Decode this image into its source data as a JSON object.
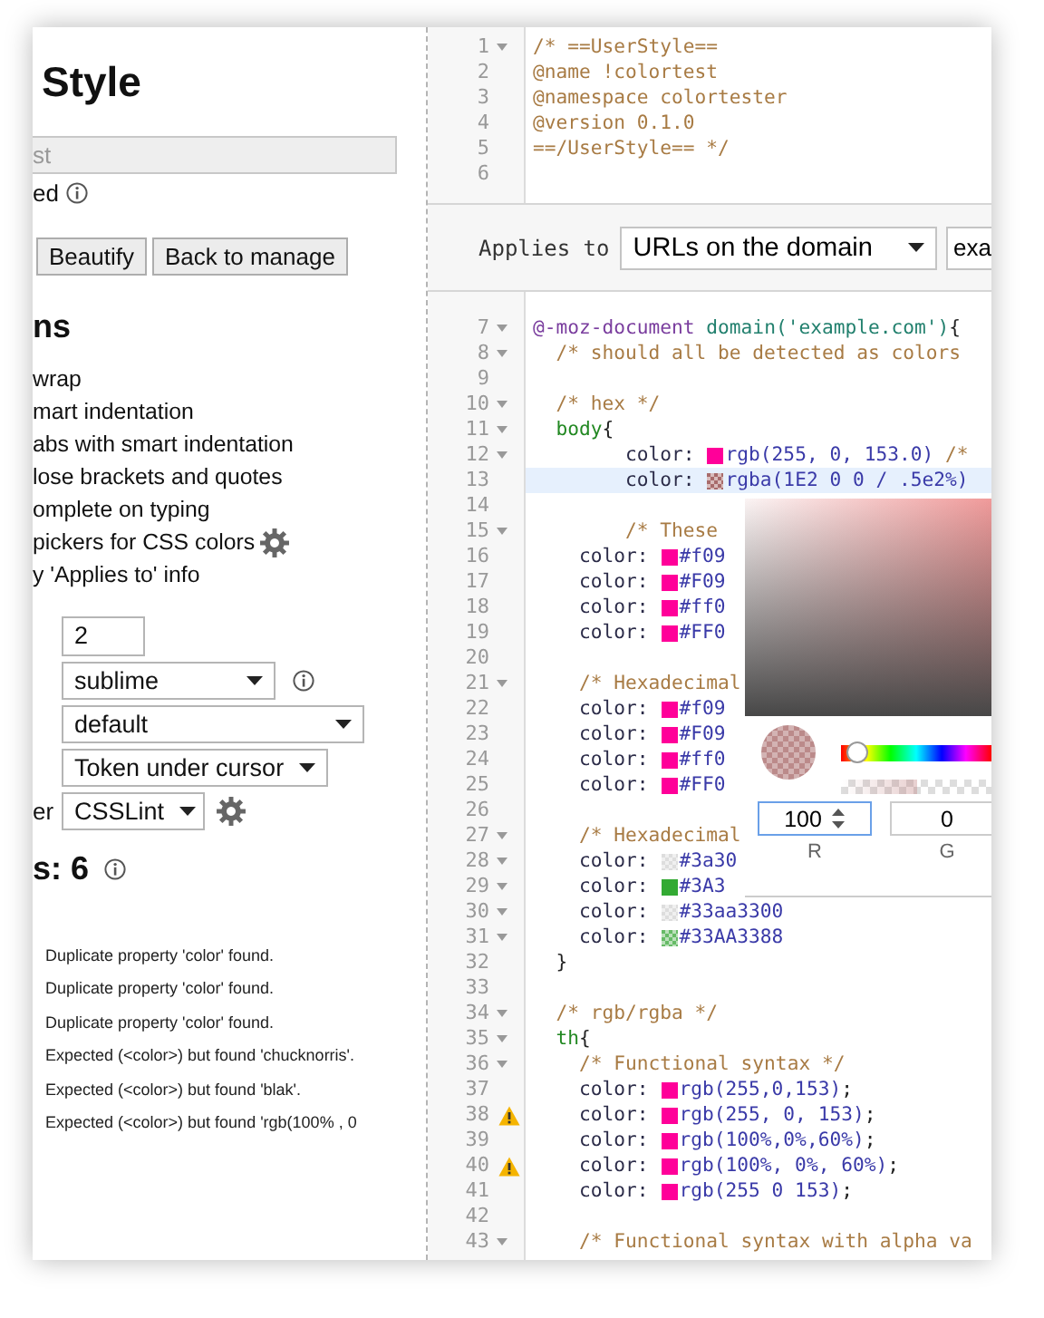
{
  "left_panel": {
    "title": "Style",
    "name_field": {
      "placeholder": "st"
    },
    "enabled": {
      "label": "ed",
      "info": true
    },
    "buttons": [
      {
        "label": "Beautify"
      },
      {
        "label": "Back to manage"
      }
    ],
    "options_heading": "ns",
    "options": [
      {
        "label": "wrap",
        "settings": false
      },
      {
        "label": "mart indentation",
        "settings": false
      },
      {
        "label": "abs with smart indentation",
        "settings": false
      },
      {
        "label": "lose brackets and quotes",
        "settings": false
      },
      {
        "label": "omplete on typing",
        "settings": false
      },
      {
        "label": "pickers for CSS colors",
        "settings": true
      },
      {
        "label": "y 'Applies to' info",
        "settings": false
      }
    ],
    "editor_settings": [
      {
        "kind": "input",
        "value": "2"
      },
      {
        "kind": "select",
        "value": "sublime",
        "info": true,
        "settings": false
      },
      {
        "kind": "select",
        "value": "default",
        "info": false,
        "settings": false
      },
      {
        "kind": "select",
        "value": "Token under cursor",
        "info": false,
        "settings": false
      },
      {
        "kind": "select",
        "label": "er",
        "value": "CSSLint",
        "info": false,
        "settings": true
      }
    ],
    "issues": {
      "heading": "s: 6",
      "info": true,
      "items": [
        "Duplicate property 'color' found.",
        "Duplicate property 'color' found.",
        "Duplicate property 'color' found.",
        "Expected (<color>) but found 'chucknorris'.",
        "Expected (<color>) but found 'blak'.",
        "Expected (<color>) but found 'rgb(100% , 0"
      ]
    }
  },
  "editor": {
    "header_lines": [
      {
        "number": "1",
        "fold": true,
        "warning": false,
        "active": false,
        "tokens": [
          {
            "kind": "comment",
            "text": "/* ==UserStyle=="
          }
        ]
      },
      {
        "number": "2",
        "fold": false,
        "warning": false,
        "active": false,
        "tokens": [
          {
            "kind": "comment",
            "text": "@name !colortest"
          }
        ]
      },
      {
        "number": "3",
        "fold": false,
        "warning": false,
        "active": false,
        "tokens": [
          {
            "kind": "comment",
            "text": "@namespace colortester"
          }
        ]
      },
      {
        "number": "4",
        "fold": false,
        "warning": false,
        "active": false,
        "tokens": [
          {
            "kind": "comment",
            "text": "@version 0.1.0"
          }
        ]
      },
      {
        "number": "5",
        "fold": false,
        "warning": false,
        "active": false,
        "tokens": [
          {
            "kind": "comment",
            "text": "==/UserStyle== */"
          }
        ]
      },
      {
        "number": "6",
        "fold": false,
        "warning": false,
        "active": false
      }
    ],
    "applies_to": {
      "label": "Applies to",
      "type": "URLs on the domain",
      "value": "exa"
    },
    "lines": [
      {
        "number": "7",
        "fold": true,
        "warning": false,
        "active": false,
        "tokens": [
          {
            "kind": "keyword",
            "text": "@-moz-document"
          },
          {
            "kind": "function",
            "text": " domain('example.com')"
          },
          {
            "kind": "plain",
            "text": "{"
          }
        ]
      },
      {
        "number": "8",
        "fold": true,
        "warning": false,
        "active": false,
        "tokens": [
          {
            "kind": "comment",
            "text": "  /* should all be detected as colors"
          }
        ]
      },
      {
        "number": "9",
        "fold": false,
        "warning": false,
        "active": false
      },
      {
        "number": "10",
        "fold": true,
        "warning": false,
        "active": false,
        "tokens": [
          {
            "kind": "comment",
            "text": "  /* hex */"
          }
        ]
      },
      {
        "number": "11",
        "fold": true,
        "warning": false,
        "active": false,
        "tokens": [
          {
            "kind": "tag",
            "text": "  body"
          },
          {
            "kind": "plain",
            "text": "{"
          }
        ]
      },
      {
        "number": "12",
        "fold": true,
        "warning": false,
        "active": false,
        "tokens": [
          {
            "kind": "property",
            "text": "        color:"
          },
          {
            "kind": "swatch",
            "color": "#ff0099",
            "checkered": false
          },
          {
            "kind": "atom",
            "text": "rgb(255, 0, 153.0)"
          },
          {
            "kind": "comment",
            "text": " /*"
          }
        ]
      },
      {
        "number": "13",
        "fold": false,
        "warning": false,
        "active": true,
        "tokens": [
          {
            "kind": "property",
            "text": "        color:"
          },
          {
            "kind": "swatch",
            "color": "#a86b6b",
            "checkered": true
          },
          {
            "kind": "atom",
            "text": "rgba(1E2 0 0 / .5e2%)"
          }
        ]
      },
      {
        "number": "14",
        "fold": false,
        "warning": false,
        "active": false
      },
      {
        "number": "15",
        "fold": true,
        "warning": false,
        "active": false,
        "tokens": [
          {
            "kind": "comment",
            "text": "        /* These"
          }
        ]
      },
      {
        "number": "16",
        "fold": false,
        "warning": false,
        "active": false,
        "tokens": [
          {
            "kind": "property",
            "text": "    color:"
          },
          {
            "kind": "swatch",
            "color": "#ff0099",
            "checkered": false
          },
          {
            "kind": "atom",
            "text": "#f09"
          }
        ]
      },
      {
        "number": "17",
        "fold": false,
        "warning": false,
        "active": false,
        "tokens": [
          {
            "kind": "property",
            "text": "    color:"
          },
          {
            "kind": "swatch",
            "color": "#ff0099",
            "checkered": false
          },
          {
            "kind": "atom",
            "text": "#F09"
          }
        ]
      },
      {
        "number": "18",
        "fold": false,
        "warning": false,
        "active": false,
        "tokens": [
          {
            "kind": "property",
            "text": "    color:"
          },
          {
            "kind": "swatch",
            "color": "#ff0099",
            "checkered": false
          },
          {
            "kind": "atom",
            "text": "#ff0"
          }
        ]
      },
      {
        "number": "19",
        "fold": false,
        "warning": false,
        "active": false,
        "tokens": [
          {
            "kind": "property",
            "text": "    color:"
          },
          {
            "kind": "swatch",
            "color": "#ff0099",
            "checkered": false
          },
          {
            "kind": "atom",
            "text": "#FF0"
          }
        ]
      },
      {
        "number": "20",
        "fold": false,
        "warning": false,
        "active": false
      },
      {
        "number": "21",
        "fold": true,
        "warning": false,
        "active": false,
        "tokens": [
          {
            "kind": "comment",
            "text": "    /* Hexadecimal"
          }
        ]
      },
      {
        "number": "22",
        "fold": false,
        "warning": false,
        "active": false,
        "tokens": [
          {
            "kind": "property",
            "text": "    color:"
          },
          {
            "kind": "swatch",
            "color": "#ff0099",
            "checkered": false
          },
          {
            "kind": "atom",
            "text": "#f09"
          }
        ]
      },
      {
        "number": "23",
        "fold": false,
        "warning": false,
        "active": false,
        "tokens": [
          {
            "kind": "property",
            "text": "    color:"
          },
          {
            "kind": "swatch",
            "color": "#ff0099",
            "checkered": false
          },
          {
            "kind": "atom",
            "text": "#F09"
          }
        ]
      },
      {
        "number": "24",
        "fold": false,
        "warning": false,
        "active": false,
        "tokens": [
          {
            "kind": "property",
            "text": "    color:"
          },
          {
            "kind": "swatch",
            "color": "#ff0099",
            "checkered": false
          },
          {
            "kind": "atom",
            "text": "#ff0"
          }
        ]
      },
      {
        "number": "25",
        "fold": false,
        "warning": false,
        "active": false,
        "tokens": [
          {
            "kind": "property",
            "text": "    color:"
          },
          {
            "kind": "swatch",
            "color": "#ff0099",
            "checkered": false
          },
          {
            "kind": "atom",
            "text": "#FF0"
          }
        ]
      },
      {
        "number": "26",
        "fold": false,
        "warning": false,
        "active": false
      },
      {
        "number": "27",
        "fold": true,
        "warning": false,
        "active": false,
        "tokens": [
          {
            "kind": "comment",
            "text": "    /* Hexadecimal"
          }
        ]
      },
      {
        "number": "28",
        "fold": true,
        "warning": false,
        "active": false,
        "tokens": [
          {
            "kind": "property",
            "text": "    color:"
          },
          {
            "kind": "swatch",
            "color": "#dddddd",
            "checkered": true
          },
          {
            "kind": "atom",
            "text": "#3a30"
          }
        ]
      },
      {
        "number": "29",
        "fold": true,
        "warning": false,
        "active": false,
        "tokens": [
          {
            "kind": "property",
            "text": "    color:"
          },
          {
            "kind": "swatch",
            "color": "#33aa33",
            "checkered": false
          },
          {
            "kind": "atom",
            "text": "#3A3"
          }
        ]
      },
      {
        "number": "30",
        "fold": true,
        "warning": false,
        "active": false,
        "tokens": [
          {
            "kind": "property",
            "text": "    color:"
          },
          {
            "kind": "swatch",
            "color": "#dddddd",
            "checkered": true
          },
          {
            "kind": "atom",
            "text": "#33aa3300"
          }
        ]
      },
      {
        "number": "31",
        "fold": true,
        "warning": false,
        "active": false,
        "tokens": [
          {
            "kind": "property",
            "text": "    color:"
          },
          {
            "kind": "swatch",
            "color": "#66bb66",
            "checkered": true
          },
          {
            "kind": "atom",
            "text": "#33AA3388"
          }
        ]
      },
      {
        "number": "32",
        "fold": false,
        "warning": false,
        "active": false,
        "tokens": [
          {
            "kind": "plain",
            "text": "  }"
          }
        ]
      },
      {
        "number": "33",
        "fold": false,
        "warning": false,
        "active": false
      },
      {
        "number": "34",
        "fold": true,
        "warning": false,
        "active": false,
        "tokens": [
          {
            "kind": "comment",
            "text": "  /* rgb/rgba */"
          }
        ]
      },
      {
        "number": "35",
        "fold": true,
        "warning": false,
        "active": false,
        "tokens": [
          {
            "kind": "tag",
            "text": "  th"
          },
          {
            "kind": "plain",
            "text": "{"
          }
        ]
      },
      {
        "number": "36",
        "fold": true,
        "warning": false,
        "active": false,
        "tokens": [
          {
            "kind": "comment",
            "text": "    /* Functional syntax */"
          }
        ]
      },
      {
        "number": "37",
        "fold": false,
        "warning": false,
        "active": false,
        "tokens": [
          {
            "kind": "property",
            "text": "    color:"
          },
          {
            "kind": "swatch",
            "color": "#ff0099",
            "checkered": false
          },
          {
            "kind": "atom",
            "text": "rgb(255,0,153)"
          },
          {
            "kind": "plain",
            "text": ";"
          }
        ]
      },
      {
        "number": "38",
        "fold": false,
        "warning": true,
        "active": false,
        "tokens": [
          {
            "kind": "property",
            "text": "    color:"
          },
          {
            "kind": "swatch",
            "color": "#ff0099",
            "checkered": false
          },
          {
            "kind": "atom",
            "text": "rgb(255, 0, 153)"
          },
          {
            "kind": "plain",
            "text": ";"
          }
        ]
      },
      {
        "number": "39",
        "fold": false,
        "warning": false,
        "active": false,
        "tokens": [
          {
            "kind": "property",
            "text": "    color:"
          },
          {
            "kind": "swatch",
            "color": "#ff0099",
            "checkered": false
          },
          {
            "kind": "atom",
            "text": "rgb(100%,0%,60%)"
          },
          {
            "kind": "plain",
            "text": ";"
          }
        ]
      },
      {
        "number": "40",
        "fold": false,
        "warning": true,
        "active": false,
        "tokens": [
          {
            "kind": "property",
            "text": "    color:"
          },
          {
            "kind": "swatch",
            "color": "#ff0099",
            "checkered": false
          },
          {
            "kind": "atom",
            "text": "rgb(100%, 0%, 60%)"
          },
          {
            "kind": "plain",
            "text": ";"
          }
        ]
      },
      {
        "number": "41",
        "fold": false,
        "warning": false,
        "active": false,
        "tokens": [
          {
            "kind": "property",
            "text": "    color:"
          },
          {
            "kind": "swatch",
            "color": "#ff0099",
            "checkered": false
          },
          {
            "kind": "atom",
            "text": "rgb(255 0 153)"
          },
          {
            "kind": "plain",
            "text": ";"
          }
        ]
      },
      {
        "number": "42",
        "fold": false,
        "warning": false,
        "active": false
      },
      {
        "number": "43",
        "fold": true,
        "warning": false,
        "active": false,
        "tokens": [
          {
            "kind": "comment",
            "text": "    /* Functional syntax with alpha va"
          }
        ]
      }
    ],
    "color_picker": {
      "hue": {
        "level": 0
      },
      "opacity": {
        "level": 0.5
      },
      "fields": [
        {
          "label": "R",
          "value": "100",
          "focused": true
        },
        {
          "label": "G",
          "value": "0",
          "focused": false
        }
      ]
    }
  }
}
